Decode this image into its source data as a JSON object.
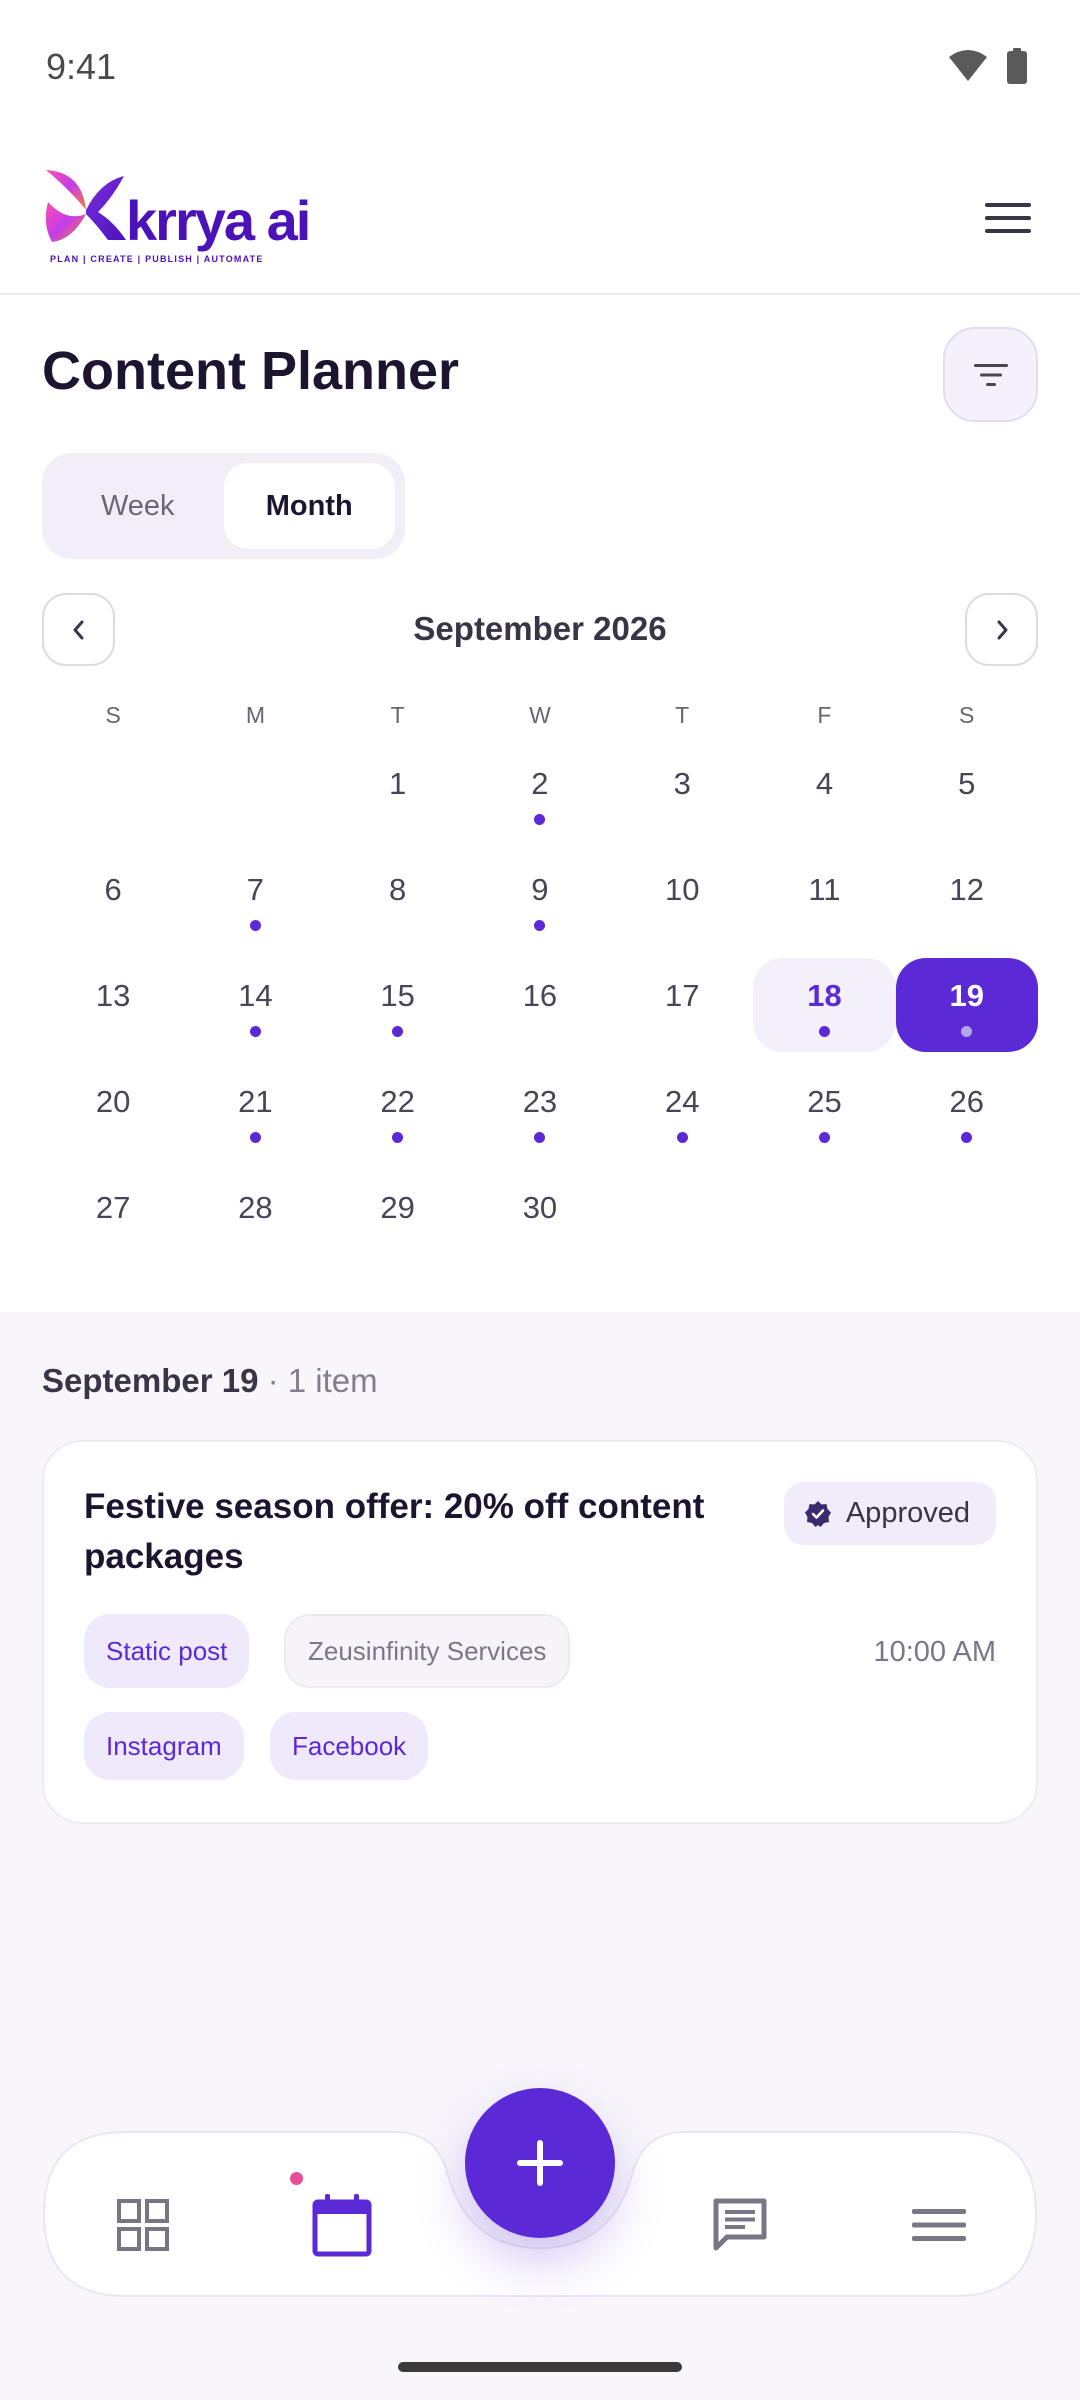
{
  "status_bar": {
    "time": "9:41"
  },
  "header": {
    "logo_text": "krrya ai",
    "logo_tagline": "PLAN | CREATE | PUBLISH | AUTOMATE"
  },
  "page": {
    "title": "Content Planner"
  },
  "view_toggle": {
    "week_label": "Week",
    "month_label": "Month",
    "selected": "Month"
  },
  "calendar": {
    "month_label": "September 2026",
    "weekdays": [
      "S",
      "M",
      "T",
      "W",
      "T",
      "F",
      "S"
    ],
    "weeks": [
      [
        "",
        "",
        "1",
        "2",
        "3",
        "4",
        "5"
      ],
      [
        "6",
        "7",
        "8",
        "9",
        "10",
        "11",
        "12"
      ],
      [
        "13",
        "14",
        "15",
        "16",
        "17",
        "18",
        "19"
      ],
      [
        "20",
        "21",
        "22",
        "23",
        "24",
        "25",
        "26"
      ],
      [
        "27",
        "28",
        "29",
        "30",
        "",
        "",
        ""
      ]
    ],
    "days_with_content": [
      "2",
      "7",
      "9",
      "14",
      "15",
      "18",
      "19",
      "21",
      "22",
      "23",
      "24",
      "25",
      "26"
    ],
    "today": "18",
    "selected_day": "19"
  },
  "agenda": {
    "date_heading": "September 19",
    "count_text": "· 1 item",
    "items": [
      {
        "title": "Festive season offer: 20% off content packages",
        "status": "Approved",
        "type_chip": "Static post",
        "client_chip": "Zeusinfinity Services",
        "time": "10:00 AM",
        "platforms": [
          "Instagram",
          "Facebook"
        ]
      }
    ]
  },
  "colors": {
    "accent": "#5b2ad6",
    "accent_light": "#efe9fb",
    "notification": "#e84d9a"
  },
  "bottom_nav": {
    "items": [
      "grid-icon",
      "calendar-icon",
      "add-icon",
      "chat-icon",
      "menu-icon"
    ],
    "active": "calendar-icon"
  }
}
